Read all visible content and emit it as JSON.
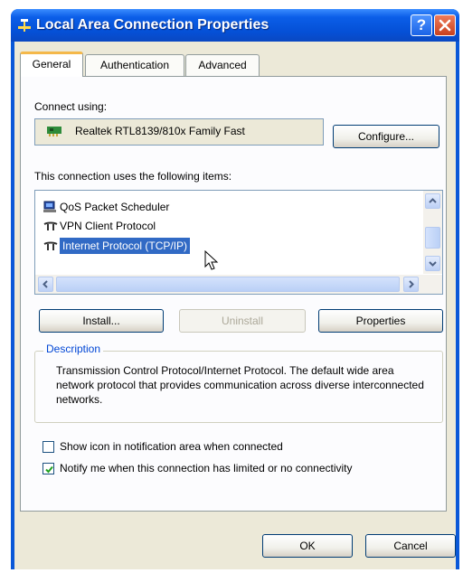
{
  "window": {
    "title": "Local Area Connection Properties",
    "help_label": "?"
  },
  "tabs": [
    {
      "label": "General"
    },
    {
      "label": "Authentication"
    },
    {
      "label": "Advanced"
    }
  ],
  "general": {
    "connect_using_label": "Connect using:",
    "adapter_name": "Realtek RTL8139/810x Family Fast",
    "configure_label": "Configure...",
    "items_label": "This connection uses the following items:",
    "items": [
      {
        "label": "QoS Packet Scheduler",
        "icon": "scheduler-icon"
      },
      {
        "label": "VPN Client Protocol",
        "icon": "protocol-icon"
      },
      {
        "label": "Internet Protocol (TCP/IP)",
        "icon": "protocol-icon",
        "selected": true
      }
    ],
    "install_label": "Install...",
    "uninstall_label": "Uninstall",
    "properties_label": "Properties",
    "description_title": "Description",
    "description_text": "Transmission Control Protocol/Internet Protocol. The default wide area network protocol that provides communication across diverse interconnected networks.",
    "show_icon_label": "Show icon in notification area when connected",
    "show_icon_checked": false,
    "notify_label": "Notify me when this connection has limited or no connectivity",
    "notify_checked": true
  },
  "footer": {
    "ok_label": "OK",
    "cancel_label": "Cancel"
  },
  "colors": {
    "titlebar": "#0550d6",
    "selection": "#316ac5",
    "dialog_bg": "#ece9d8",
    "group_title": "#0046d5"
  }
}
